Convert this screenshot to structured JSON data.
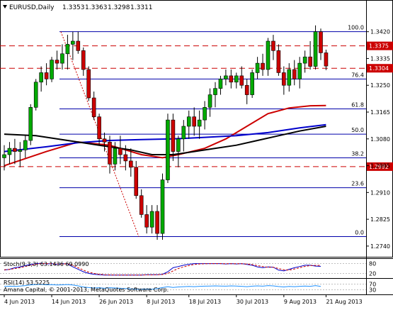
{
  "chart_data": [
    {
      "type": "candlestick",
      "title": "EURUSD,Daily",
      "ohlc_header": [
        "1.3353",
        "1.3363",
        "1.3298",
        "1.3311"
      ],
      "x_ticks": [
        "4 Jun 2013",
        "14 Jun 2013",
        "26 Jun 2013",
        "8 Jul 2013",
        "18 Jul 2013",
        "30 Jul 2013",
        "9 Aug 2013",
        "21 Aug 2013"
      ],
      "y_ticks": [
        "1.3420",
        "1.3335",
        "1.3250",
        "1.3165",
        "1.3080",
        "1.2995",
        "1.2910",
        "1.2825",
        "1.2740"
      ],
      "ylim": [
        1.2715,
        1.348
      ],
      "candles": [
        [
          1.302,
          1.306,
          1.298,
          1.303
        ],
        [
          1.303,
          1.307,
          1.3,
          1.305
        ],
        [
          1.305,
          1.308,
          1.3,
          1.304
        ],
        [
          1.304,
          1.307,
          1.299,
          1.3045
        ],
        [
          1.3045,
          1.309,
          1.302,
          1.3075
        ],
        [
          1.3075,
          1.319,
          1.306,
          1.318
        ],
        [
          1.318,
          1.327,
          1.317,
          1.326
        ],
        [
          1.326,
          1.331,
          1.323,
          1.329
        ],
        [
          1.329,
          1.332,
          1.325,
          1.327
        ],
        [
          1.327,
          1.334,
          1.326,
          1.333
        ],
        [
          1.333,
          1.336,
          1.33,
          1.332
        ],
        [
          1.332,
          1.338,
          1.33,
          1.335
        ],
        [
          1.335,
          1.341,
          1.33,
          1.338
        ],
        [
          1.338,
          1.342,
          1.333,
          1.339
        ],
        [
          1.339,
          1.342,
          1.335,
          1.336
        ],
        [
          1.336,
          1.337,
          1.328,
          1.33
        ],
        [
          1.33,
          1.331,
          1.32,
          1.321
        ],
        [
          1.321,
          1.323,
          1.314,
          1.315
        ],
        [
          1.315,
          1.316,
          1.306,
          1.308
        ],
        [
          1.308,
          1.31,
          1.304,
          1.307
        ],
        [
          1.307,
          1.309,
          1.297,
          1.3
        ],
        [
          1.3,
          1.307,
          1.298,
          1.305
        ],
        [
          1.305,
          1.309,
          1.3,
          1.303
        ],
        [
          1.303,
          1.306,
          1.298,
          1.301
        ],
        [
          1.301,
          1.305,
          1.296,
          1.299
        ],
        [
          1.299,
          1.301,
          1.289,
          1.29
        ],
        [
          1.29,
          1.292,
          1.283,
          1.284
        ],
        [
          1.284,
          1.287,
          1.278,
          1.28
        ],
        [
          1.28,
          1.287,
          1.278,
          1.285
        ],
        [
          1.285,
          1.287,
          1.276,
          1.278
        ],
        [
          1.278,
          1.297,
          1.276,
          1.295
        ],
        [
          1.295,
          1.316,
          1.294,
          1.314
        ],
        [
          1.314,
          1.316,
          1.301,
          1.304
        ],
        [
          1.304,
          1.309,
          1.299,
          1.308
        ],
        [
          1.308,
          1.314,
          1.304,
          1.312
        ],
        [
          1.312,
          1.317,
          1.308,
          1.315
        ],
        [
          1.315,
          1.318,
          1.309,
          1.312
        ],
        [
          1.312,
          1.317,
          1.308,
          1.314
        ],
        [
          1.314,
          1.32,
          1.311,
          1.318
        ],
        [
          1.318,
          1.324,
          1.315,
          1.322
        ],
        [
          1.322,
          1.326,
          1.318,
          1.324
        ],
        [
          1.324,
          1.328,
          1.322,
          1.327
        ],
        [
          1.327,
          1.33,
          1.325,
          1.328
        ],
        [
          1.328,
          1.33,
          1.324,
          1.326
        ],
        [
          1.326,
          1.329,
          1.324,
          1.328
        ],
        [
          1.328,
          1.331,
          1.324,
          1.325
        ],
        [
          1.325,
          1.327,
          1.319,
          1.322
        ],
        [
          1.322,
          1.33,
          1.321,
          1.329
        ],
        [
          1.329,
          1.334,
          1.327,
          1.332
        ],
        [
          1.332,
          1.335,
          1.328,
          1.33
        ],
        [
          1.33,
          1.34,
          1.328,
          1.339
        ],
        [
          1.339,
          1.341,
          1.333,
          1.336
        ],
        [
          1.336,
          1.338,
          1.328,
          1.329
        ],
        [
          1.329,
          1.331,
          1.322,
          1.325
        ],
        [
          1.325,
          1.332,
          1.323,
          1.33
        ],
        [
          1.33,
          1.333,
          1.325,
          1.327
        ],
        [
          1.327,
          1.334,
          1.324,
          1.332
        ],
        [
          1.332,
          1.336,
          1.329,
          1.334
        ],
        [
          1.334,
          1.339,
          1.33,
          1.331
        ],
        [
          1.331,
          1.344,
          1.33,
          1.342
        ],
        [
          1.342,
          1.343,
          1.333,
          1.3353
        ],
        [
          1.3353,
          1.3363,
          1.3298,
          1.3311
        ]
      ],
      "moving_averages": [
        {
          "color": "#cc0000",
          "points": [
            [
              0,
              1.2995
            ],
            [
              8,
              1.304
            ],
            [
              14,
              1.307
            ],
            [
              20,
              1.306
            ],
            [
              26,
              1.303
            ],
            [
              30,
              1.302
            ],
            [
              33,
              1.303
            ],
            [
              38,
              1.305
            ],
            [
              42,
              1.308
            ],
            [
              46,
              1.312
            ],
            [
              50,
              1.316
            ],
            [
              54,
              1.3178
            ],
            [
              58,
              1.3185
            ],
            [
              61,
              1.3186
            ]
          ]
        },
        {
          "color": "#0000cc",
          "points": [
            [
              0,
              1.304
            ],
            [
              8,
              1.3055
            ],
            [
              14,
              1.3068
            ],
            [
              20,
              1.3075
            ],
            [
              26,
              1.3078
            ],
            [
              32,
              1.308
            ],
            [
              38,
              1.3085
            ],
            [
              44,
              1.309
            ],
            [
              50,
              1.31
            ],
            [
              56,
              1.3115
            ],
            [
              61,
              1.3125
            ]
          ]
        },
        {
          "color": "#000000",
          "points": [
            [
              0,
              1.3095
            ],
            [
              6,
              1.309
            ],
            [
              12,
              1.3075
            ],
            [
              18,
              1.306
            ],
            [
              24,
              1.3045
            ],
            [
              28,
              1.303
            ],
            [
              32,
              1.303
            ],
            [
              36,
              1.304
            ],
            [
              40,
              1.305
            ],
            [
              44,
              1.306
            ],
            [
              48,
              1.3075
            ],
            [
              52,
              1.309
            ],
            [
              56,
              1.3105
            ],
            [
              61,
              1.312
            ]
          ]
        }
      ],
      "fibonacci": [
        {
          "label": "100.0",
          "value": 1.342
        },
        {
          "label": "76.4",
          "value": 1.327
        },
        {
          "label": "61.8",
          "value": 1.3175
        },
        {
          "label": "50.0",
          "value": 1.3095
        },
        {
          "label": "38.2",
          "value": 1.302
        },
        {
          "label": "23.6",
          "value": 1.2925
        },
        {
          "label": "0.0",
          "value": 1.277
        }
      ],
      "horizontal_levels": [
        {
          "label": "1.3375",
          "value": 1.3375
        },
        {
          "label": "1.3304",
          "value": 1.3304
        },
        {
          "label": "1.2992",
          "value": 1.2992
        }
      ]
    },
    {
      "type": "line",
      "title": "Stoch(9,3,3) 63.1436 69.0990",
      "ylim": [
        0,
        100
      ],
      "y_ticks": [
        "80",
        "20"
      ],
      "series": [
        {
          "color": "#0000cc",
          "values": [
            40,
            45,
            55,
            60,
            68,
            75,
            80,
            82,
            78,
            80,
            75,
            80,
            78,
            60,
            45,
            30,
            20,
            15,
            12,
            10,
            10,
            10,
            10,
            10,
            10,
            10,
            10,
            12,
            12,
            12,
            15,
            30,
            55,
            62,
            70,
            76,
            80,
            80,
            80,
            80,
            80,
            80,
            78,
            80,
            78,
            80,
            75,
            70,
            60,
            55,
            60,
            58,
            40,
            35,
            45,
            55,
            62,
            70,
            70,
            65,
            63
          ]
        },
        {
          "color": "#cc0000",
          "dashed": true,
          "values": [
            42,
            44,
            50,
            55,
            62,
            70,
            76,
            80,
            80,
            79,
            78,
            78,
            79,
            70,
            55,
            40,
            28,
            20,
            15,
            12,
            11,
            10,
            10,
            10,
            10,
            10,
            10,
            11,
            11,
            12,
            13,
            20,
            35,
            50,
            60,
            68,
            75,
            78,
            79,
            80,
            80,
            80,
            79,
            79,
            79,
            79,
            78,
            74,
            68,
            62,
            58,
            58,
            50,
            42,
            40,
            47,
            55,
            63,
            68,
            69,
            69
          ]
        }
      ]
    },
    {
      "type": "line",
      "title": "RSI(14) 53.5225",
      "ylim": [
        0,
        100
      ],
      "y_ticks": [
        "70",
        "30"
      ],
      "series": [
        {
          "color": "#1e90ff",
          "values": [
            54,
            56,
            55,
            57,
            60,
            65,
            68,
            69,
            66,
            67,
            64,
            66,
            68,
            64,
            58,
            50,
            45,
            42,
            44,
            40,
            44,
            42,
            40,
            38,
            36,
            33,
            32,
            34,
            33,
            38,
            45,
            52,
            46,
            50,
            52,
            54,
            52,
            55,
            56,
            57,
            58,
            57,
            56,
            58,
            57,
            55,
            52,
            56,
            58,
            56,
            60,
            58,
            53,
            50,
            54,
            52,
            55,
            57,
            55,
            60,
            54
          ]
        }
      ]
    }
  ],
  "footer": {
    "copyright": "Amana Capital, © 2001-2013, MetaQuotes Software Corp."
  }
}
